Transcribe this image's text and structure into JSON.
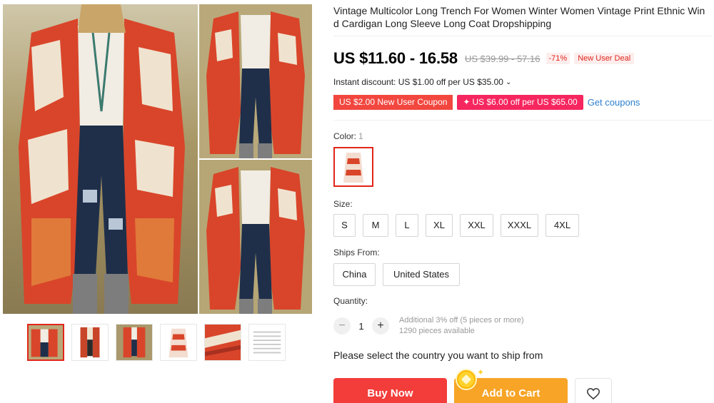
{
  "product": {
    "title": "Vintage Multicolor Long Trench For Women Winter Women Vintage Print Ethnic Wind Cardigan Long Sleeve Long Coat Dropshipping"
  },
  "pricing": {
    "price": "US $11.60 - 16.58",
    "original": "US $39.99 - 57.16",
    "discount_pct": "-71%",
    "deal_badge": "New User Deal"
  },
  "discount": {
    "instant": "Instant discount: US $1.00 off per US $35.00",
    "chevron_icon": "chevron-down-icon"
  },
  "coupons": {
    "items": [
      {
        "label": "US $2.00 New User Coupon"
      },
      {
        "label": "US $6.00 off per US $65.00",
        "icon": "sparkle-icon"
      }
    ],
    "get_label": "Get coupons"
  },
  "color": {
    "label": "Color:",
    "count": "1"
  },
  "size": {
    "label": "Size:",
    "options": [
      "S",
      "M",
      "L",
      "XL",
      "XXL",
      "XXXL",
      "4XL"
    ]
  },
  "ships_from": {
    "label": "Ships From:",
    "options": [
      "China",
      "United States"
    ]
  },
  "quantity": {
    "label": "Quantity:",
    "value": "1",
    "minus": "−",
    "plus": "+",
    "note_line1": "Additional 3% off (5 pieces or more)",
    "note_line2": "1290 pieces available"
  },
  "shipping_prompt": "Please select the country you want to ship from",
  "actions": {
    "buy_now": "Buy Now",
    "add_to_cart": "Add to Cart",
    "wishlist_icon": "heart-icon"
  },
  "colors": {
    "accent_red": "#e1251b",
    "buy_button": "#f23d3a",
    "cart_button": "#f7a427",
    "link_blue": "#2c7ecf",
    "coupon_red": "#f2473f",
    "coupon_pink": "#f6265f"
  }
}
